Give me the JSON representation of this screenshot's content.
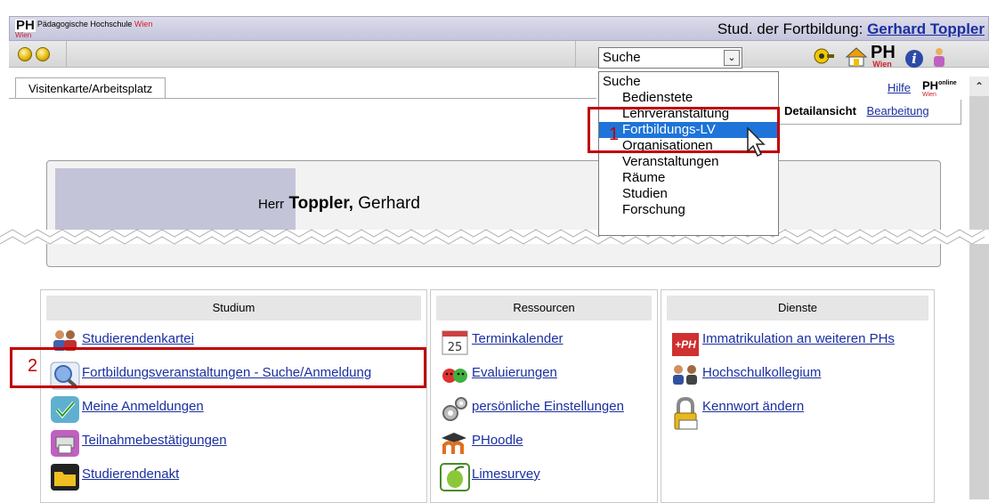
{
  "header": {
    "logo_mark": "PH",
    "logo_text": "Pädagogische Hochschule",
    "logo_text_accent": "Wien",
    "logo_sub": "Wien",
    "role": "Stud. der Fortbildung:",
    "user_name": "Gerhard Toppler"
  },
  "toolbar": {
    "select_value": "Suche",
    "ph_logo": "PH",
    "ph_logo_sub": "Wien",
    "info_symbol": "i"
  },
  "tabs": {
    "active": "Visitenkarte/Arbeitsplatz",
    "help": "Hilfe",
    "ph_online": "PH",
    "ph_online_sup": "online",
    "ph_online_sub": "Wien",
    "detail": "Detailansicht",
    "edit": "Bearbeitung"
  },
  "card": {
    "salutation": "Herr",
    "surname": "Toppler,",
    "firstname": "Gerhard"
  },
  "dropdown": {
    "items": [
      "Suche",
      "Bedienstete",
      "Lehrveranstaltung",
      "Fortbildungs-LV",
      "Organisationen",
      "Veranstaltungen",
      "Räume",
      "Studien",
      "Forschung"
    ],
    "selected": "Fortbildungs-LV"
  },
  "callouts": {
    "one": "1",
    "two": "2"
  },
  "columns": {
    "studium": {
      "title": "Studium",
      "links": [
        "Studierendenkartei",
        "Fortbildungsveranstaltungen - Suche/Anmeldung",
        "Meine Anmeldungen",
        "Teilnahmebestätigungen",
        "Studierendenakt"
      ]
    },
    "ressourcen": {
      "title": "Ressourcen",
      "calendar_day": "25",
      "links": [
        "Terminkalender",
        "Evaluierungen",
        "persönliche Einstellungen",
        "PHoodle",
        "Limesurvey"
      ]
    },
    "dienste": {
      "title": "Dienste",
      "ph_badge": "+PH",
      "links": [
        "Immatrikulation an weiteren PHs",
        "Hochschulkollegium",
        "Kennwort ändern"
      ]
    }
  }
}
